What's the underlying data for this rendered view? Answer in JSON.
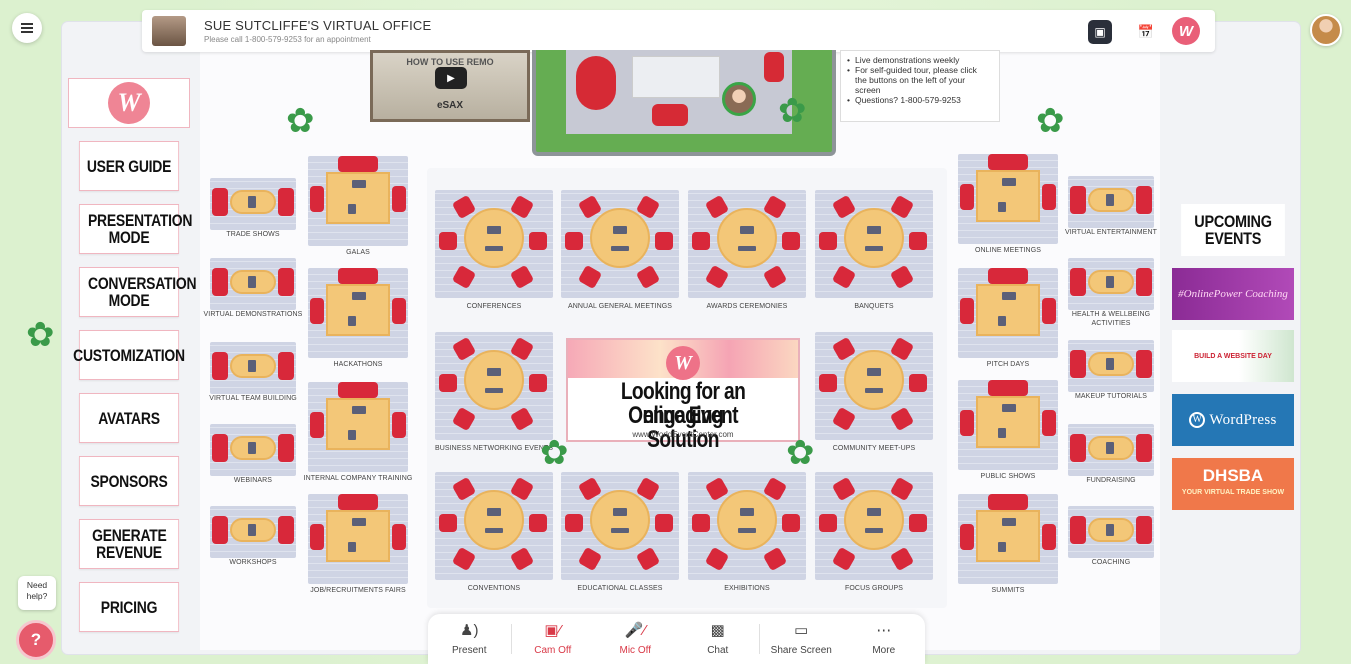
{
  "header": {
    "title": "SUE SUTCLIFFE'S VIRTUAL OFFICE",
    "subtitle": "Please call 1-800-579-9253 for an appointment"
  },
  "nav": {
    "items": [
      {
        "label": "USER GUIDE"
      },
      {
        "label": "PRESENTATION MODE"
      },
      {
        "label": "CONVERSATION MODE"
      },
      {
        "label": "CUSTOMIZATION"
      },
      {
        "label": "AVATARS"
      },
      {
        "label": "SPONSORS"
      },
      {
        "label": "GENERATE REVENUE"
      },
      {
        "label": "PRICING"
      }
    ]
  },
  "video": {
    "title": "HOW TO USE REMO",
    "brand": "eSAX"
  },
  "info": {
    "items": [
      "Live demonstrations weekly",
      "For self-guided tour, please click the buttons on the left of your screen",
      "Questions? 1-800-579-9253"
    ]
  },
  "sidebar_right": {
    "heading": "UPCOMING EVENTS",
    "sponsors": [
      {
        "text": "#OnlinePower Coaching"
      },
      {
        "text": "BUILD A WEBSITE DAY"
      },
      {
        "text": "WordPress"
      },
      {
        "text": "DHSBA",
        "sub": "YOUR VIRTUAL TRADE SHOW"
      }
    ]
  },
  "banner": {
    "line1": "Looking for an engaging",
    "line2": "Online Event Solution",
    "url": "www.WorldEventCenter.com"
  },
  "tables": {
    "left_small": [
      "TRADE SHOWS",
      "VIRTUAL DEMONSTRATIONS",
      "VIRTUAL TEAM BUILDING",
      "WEBINARS",
      "WORKSHOPS"
    ],
    "left_large": [
      "GALAS",
      "HACKATHONS",
      "INTERNAL COMPANY TRAINING",
      "JOB/RECRUITMENTS FAIRS"
    ],
    "center_top": [
      "CONFERENCES",
      "ANNUAL GENERAL MEETINGS",
      "AWARDS CEREMONIES",
      "BANQUETS"
    ],
    "center_mid": [
      "BUSINESS NETWORKING EVENTS",
      "COMMUNITY MEET-UPS"
    ],
    "center_bottom": [
      "CONVENTIONS",
      "EDUCATIONAL CLASSES",
      "EXHIBITIONS",
      "FOCUS GROUPS"
    ],
    "right_large": [
      "ONLINE MEETINGS",
      "PITCH DAYS",
      "PUBLIC SHOWS",
      "SUMMITS"
    ],
    "right_small": [
      "VIRTUAL ENTERTAINMENT",
      "HEALTH & WELLBEING ACTIVITIES",
      "MAKEUP TUTORIALS",
      "FUNDRAISING",
      "COACHING"
    ]
  },
  "help": {
    "label": "Need help?"
  },
  "toolbar": {
    "items": [
      {
        "label": "Present",
        "icon": "present-icon"
      },
      {
        "label": "Cam Off",
        "icon": "camera-off-icon"
      },
      {
        "label": "Mic Off",
        "icon": "mic-off-icon"
      },
      {
        "label": "Chat",
        "icon": "chat-icon"
      },
      {
        "label": "Share Screen",
        "icon": "share-screen-icon"
      },
      {
        "label": "More",
        "icon": "more-icon"
      }
    ]
  },
  "colors": {
    "accent": "#e95f78",
    "seat": "#d8283a",
    "table": "#f3c778",
    "floor": "#dff3d4"
  }
}
